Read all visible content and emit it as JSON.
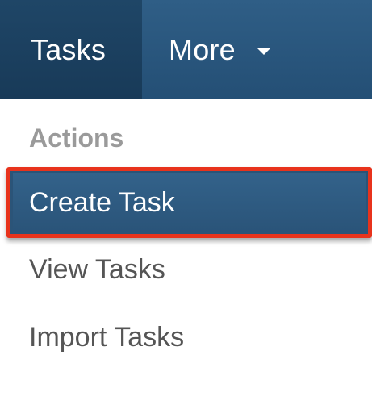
{
  "navbar": {
    "tabs": [
      {
        "label": "Tasks",
        "active": true
      },
      {
        "label": "More",
        "has_dropdown": true
      }
    ]
  },
  "dropdown": {
    "header": "Actions",
    "items": [
      {
        "label": "Create Task",
        "highlighted": true
      },
      {
        "label": "View Tasks"
      },
      {
        "label": "Import Tasks"
      }
    ]
  },
  "colors": {
    "navbar": "#2f5e86",
    "active_tab": "#1f4667",
    "highlight_border": "#e8331c",
    "highlight_fill": "#2a5479"
  }
}
